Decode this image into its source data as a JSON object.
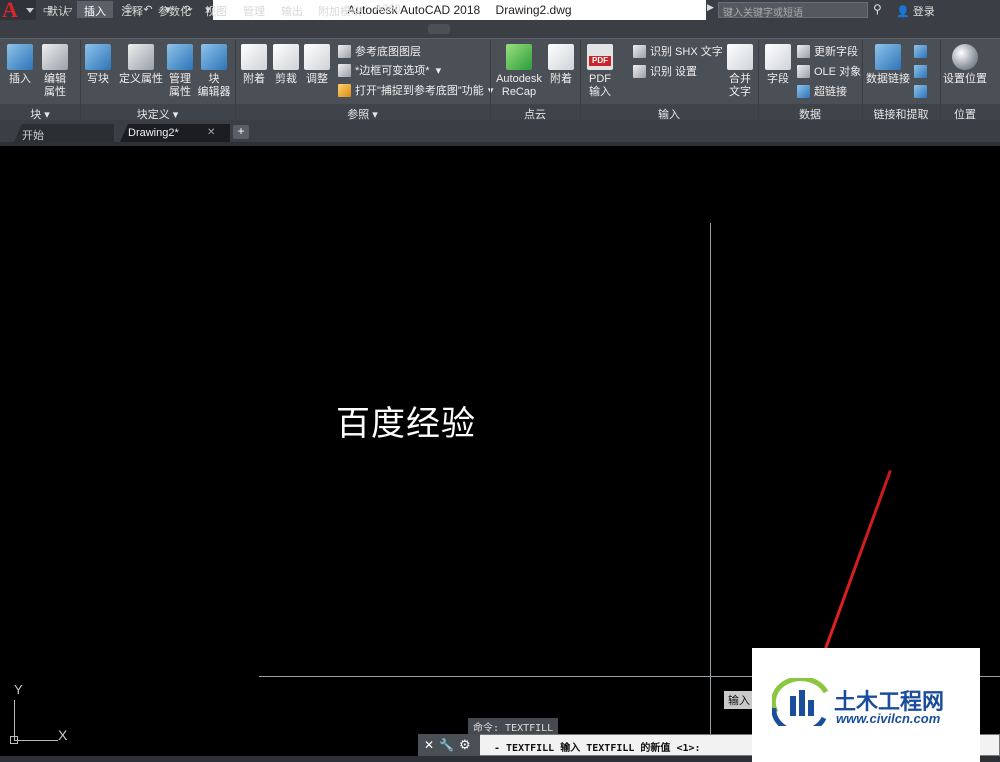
{
  "app": {
    "logo": "A",
    "title": "Autodesk AutoCAD 2018",
    "file": "Drawing2.dwg",
    "search_placeholder": "键入关键字或短语",
    "login": "登录"
  },
  "ribbon_tabs": [
    "默认",
    "插入",
    "注释",
    "参数化",
    "视图",
    "管理",
    "输出",
    "附加模块",
    "A360"
  ],
  "ribbon": {
    "block": {
      "insert": "插入",
      "edit_attr": "编辑\n属性",
      "panel": "块 ▾"
    },
    "block_def": {
      "write": "写块",
      "define_attr": "定义属性",
      "manage_attr": "管理\n属性",
      "block_editor": "块\n编辑器",
      "panel": "块定义 ▾"
    },
    "reference": {
      "attach": "附着",
      "clip": "剪裁",
      "adjust": "调整",
      "underlay_layers": "参考底图图层",
      "frame_vary": "*边框可变选项*",
      "snap_underlay": "打开\"捕捉到参考底图\"功能",
      "panel": "参照 ▾"
    },
    "pointcloud": {
      "recap": "Autodesk\nReCap",
      "attach": "附着",
      "panel": "点云"
    },
    "import": {
      "pdf_import": "PDF\n输入",
      "shx": "识别 SHX 文字",
      "recog_settings": "识别 设置",
      "combine_text": "合并\n文字",
      "panel": "输入"
    },
    "data": {
      "field": "字段",
      "update_fields": "更新字段",
      "ole": "OLE 对象",
      "hyperlink": "超链接",
      "panel": "数据"
    },
    "linking": {
      "data_link": "数据链接",
      "panel": "链接和提取"
    },
    "location": {
      "set_location": "设置位置",
      "panel": "位置"
    }
  },
  "doc_tabs": {
    "start": "开始",
    "drawing": "Drawing2*"
  },
  "canvas": {
    "text": "百度经验",
    "ucs_y": "Y",
    "ucs_x": "X",
    "input_tip": "输入",
    "command_history": "命令: TEXTFILL",
    "command_line": "- TEXTFILL 输入 TEXTFILL 的新值 <1>:"
  },
  "watermark": {
    "name": "土木工程网",
    "url": "www.civilcn.com"
  },
  "colors": {
    "accent": "#d9262b",
    "ribbon_bg": "#4b4f56",
    "canvas_bg": "#000000",
    "watermark_blue": "#1a4e9c"
  }
}
